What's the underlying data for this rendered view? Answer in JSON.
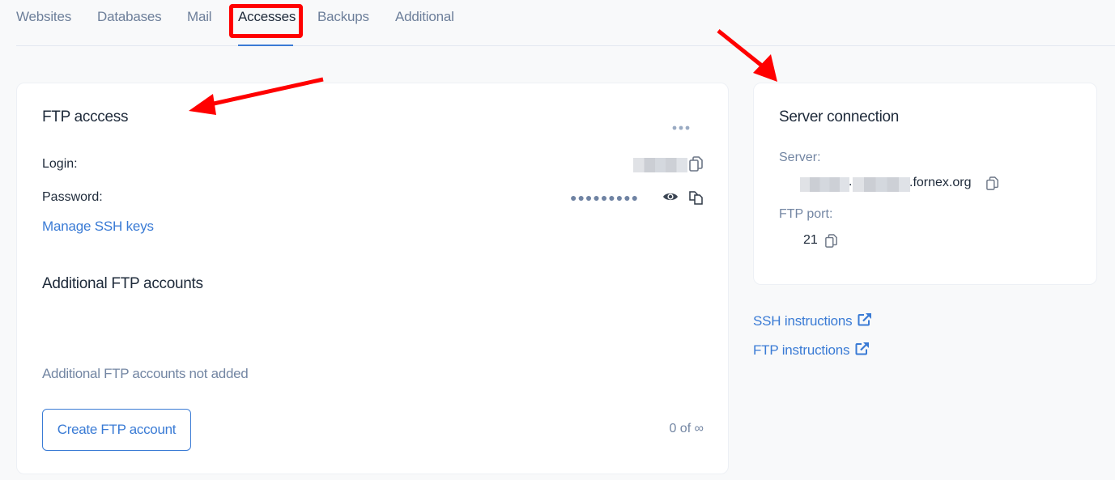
{
  "tabs": [
    {
      "label": "Websites",
      "active": false
    },
    {
      "label": "Databases",
      "active": false
    },
    {
      "label": "Mail",
      "active": false
    },
    {
      "label": "Accesses",
      "active": true
    },
    {
      "label": "Backups",
      "active": false
    },
    {
      "label": "Additional",
      "active": false
    }
  ],
  "ftp_access": {
    "title": "FTP acccess",
    "menu_icon": "more-horizontal-icon",
    "login_label": "Login:",
    "login_value": "[redacted]",
    "password_label": "Password:",
    "password_mask": "●●●●●●●●●",
    "manage_ssh_label": "Manage SSH keys",
    "additional_title": "Additional FTP accounts",
    "empty_text": "Additional FTP accounts not added",
    "create_button": "Create FTP account",
    "counter": "0 of ∞"
  },
  "server_connection": {
    "title": "Server connection",
    "server_label": "Server:",
    "server_separator": ".",
    "server_suffix": ".fornex.org",
    "port_label": "FTP port:",
    "port_value": "21"
  },
  "links": {
    "ssh_instructions": "SSH instructions",
    "ftp_instructions": "FTP instructions"
  },
  "colors": {
    "accent": "#3a7bd5",
    "annotation": "#ff0000"
  }
}
